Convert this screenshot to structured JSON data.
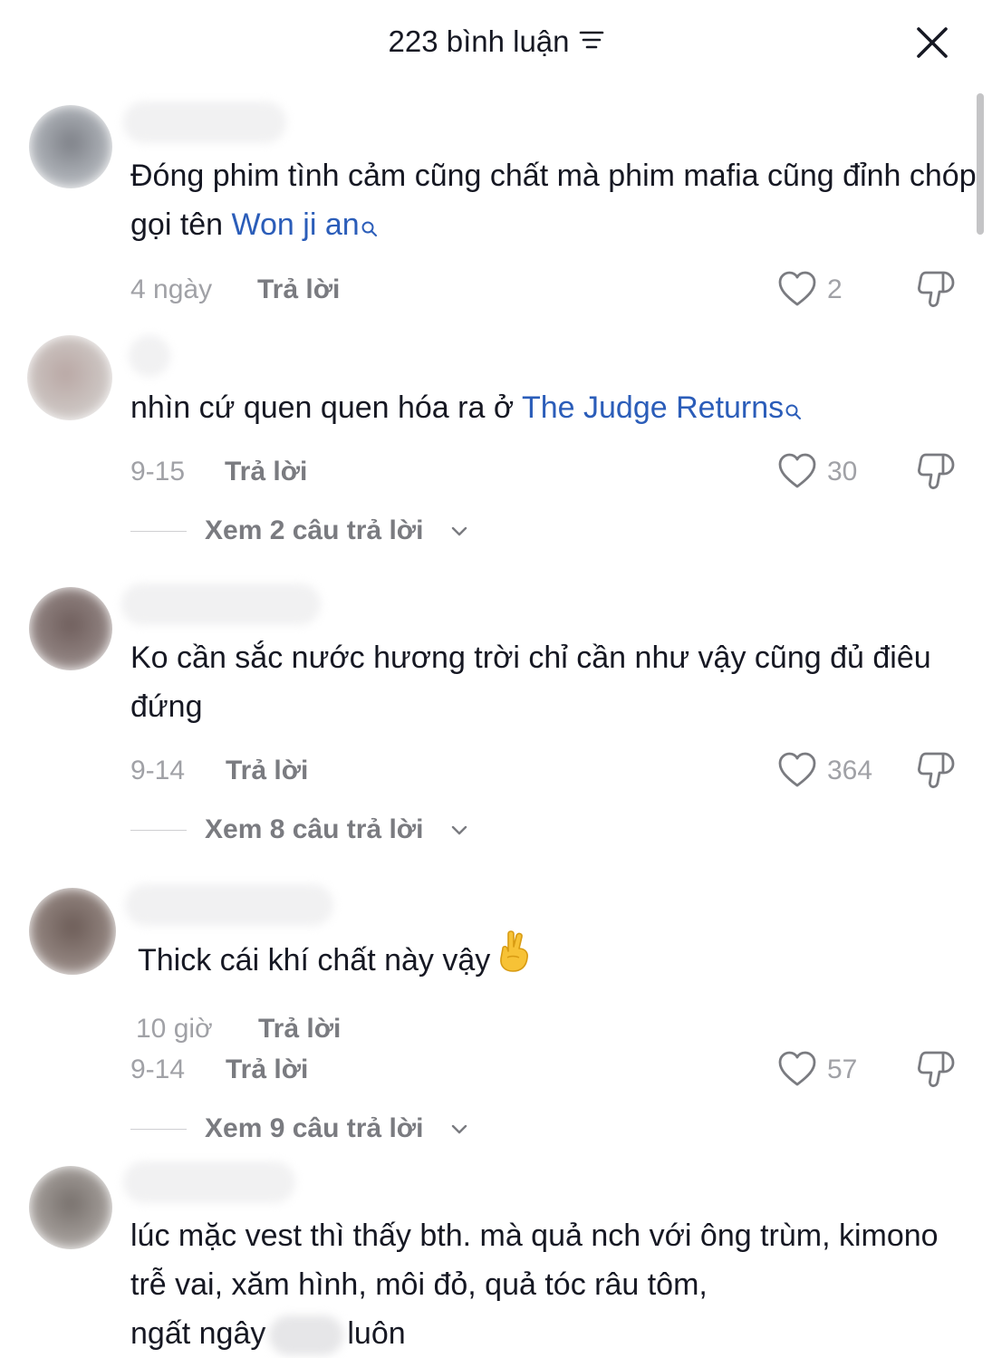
{
  "header": {
    "title": "223 bình luận",
    "sort_icon": "sort-lines-icon",
    "close_icon": "close-x-icon"
  },
  "comments": [
    {
      "text_parts": [
        "Đóng phim tình cảm cũng chất mà phim mafia cũng đỉnh chóp gọi tên "
      ],
      "link": "Won ji an",
      "date": "4 ngày",
      "reply_label": "Trả lời",
      "likes": "2"
    },
    {
      "text_parts": [
        "nhìn cứ quen quen hóa ra ở "
      ],
      "link": "The Judge Returns",
      "date": "9-15",
      "reply_label": "Trả lời",
      "likes": "30",
      "view_replies": "Xem 2 câu trả lời"
    },
    {
      "text_parts": [
        "Ko cần sắc nước hương trời chỉ cần như vậy cũng đủ điêu đứng"
      ],
      "date": "9-14",
      "reply_label": "Trả lời",
      "likes": "364",
      "view_replies": "Xem 8 câu trả lời"
    },
    {
      "text_parts": [
        "Thick cái khí chất này vậy"
      ],
      "emoji": "crossed-fingers-emoji",
      "overlay_date": "10 giờ",
      "overlay_reply_label": "Trả lời",
      "date": "9-14",
      "reply_label": "Trả lời",
      "likes": "57",
      "view_replies": "Xem 9 câu trả lời"
    },
    {
      "text_line1": "lúc mặc vest thì thấy bth. mà quả nch với ông trùm, kimono trễ vai, xăm hình, môi đỏ, quả tóc râu tôm,",
      "text_line3_start": "ngất ngây",
      "text_line3_end": "luôn"
    }
  ],
  "colors": {
    "text": "#161823",
    "link": "#2b5db9",
    "muted": "#a0a1a6",
    "reply": "#7a7b80"
  }
}
